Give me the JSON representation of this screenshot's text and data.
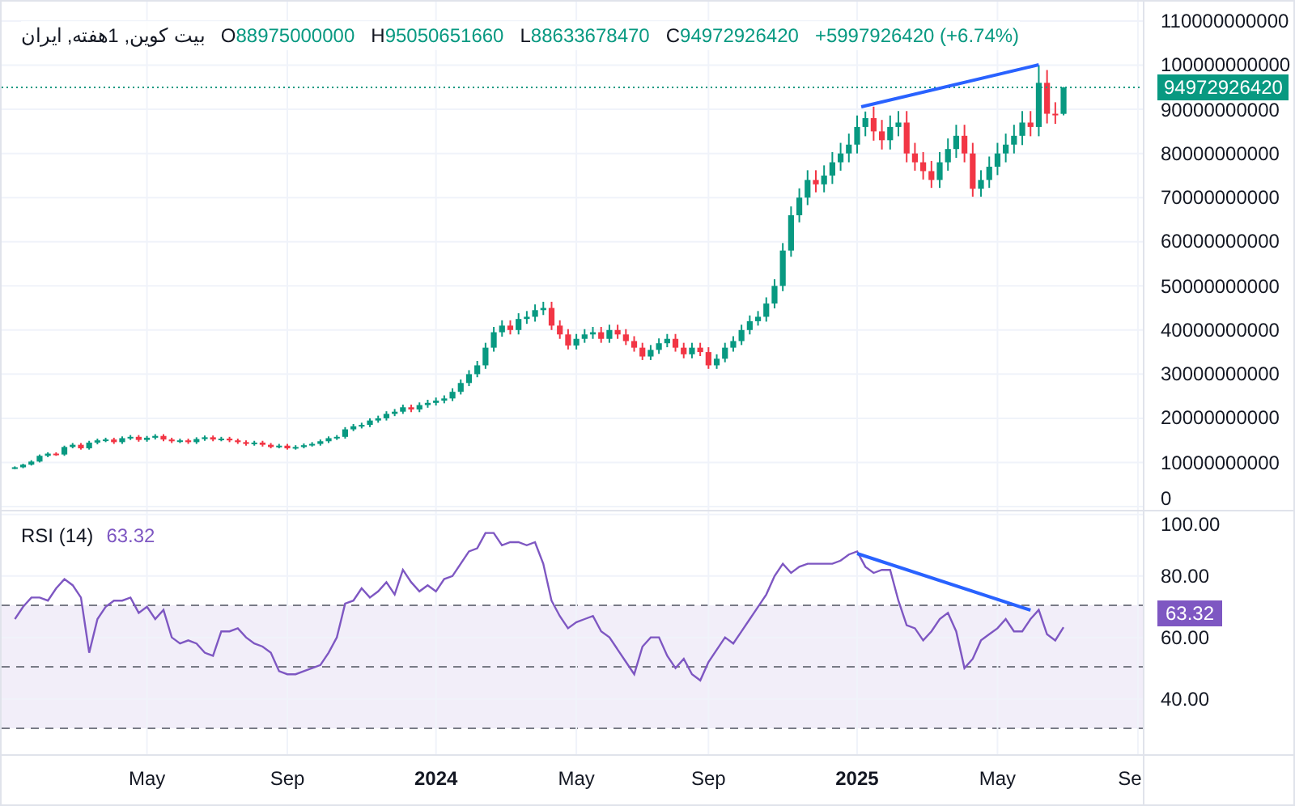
{
  "legend": {
    "symbol": "بیت کوین, 1هفته, ایران",
    "fields": [
      {
        "label": "O",
        "value": "88975000000"
      },
      {
        "label": "H",
        "value": "95050651660"
      },
      {
        "label": "L",
        "value": "88633678470"
      },
      {
        "label": "C",
        "value": "94972926420"
      }
    ],
    "change": "+5997926420 (+6.74%)"
  },
  "price_pane": {
    "last_price": "94972926420",
    "trend_line": true,
    "chart_data": {
      "type": "candlestick",
      "grid": true,
      "ylim": [
        0,
        110000000000
      ],
      "ohlc": [
        [
          8700000000.0,
          9100000000.0,
          8500000000.0,
          8900000000.0
        ],
        [
          8900000000.0,
          9700000000.0,
          8700000000.0,
          9500000000.0
        ],
        [
          9500000000.0,
          10500000000.0,
          9300000000.0,
          10200000000.0
        ],
        [
          10200000000.0,
          11800000000.0,
          10000000000.0,
          11500000000.0
        ],
        [
          11500000000.0,
          12300000000.0,
          11200000000.0,
          12000000000.0
        ],
        [
          12000000000.0,
          12300000000.0,
          11500000000.0,
          11800000000.0
        ],
        [
          11800000000.0,
          13800000000.0,
          11500000000.0,
          13500000000.0
        ],
        [
          13500000000.0,
          14400000000.0,
          13200000000.0,
          14000000000.0
        ],
        [
          14000000000.0,
          14400000000.0,
          12900000000.0,
          13200000000.0
        ],
        [
          13200000000.0,
          14900000000.0,
          12900000000.0,
          14500000000.0
        ],
        [
          14500000000.0,
          15400000000.0,
          14100000000.0,
          15000000000.0
        ],
        [
          15000000000.0,
          15600000000.0,
          14600000000.0,
          15200000000.0
        ],
        [
          15200000000.0,
          15600000000.0,
          14200000000.0,
          14600000000.0
        ],
        [
          14600000000.0,
          15900000000.0,
          14200000000.0,
          15500000000.0
        ],
        [
          15500000000.0,
          16200000000.0,
          15100000000.0,
          15800000000.0
        ],
        [
          15800000000.0,
          16200000000.0,
          14700000000.0,
          15100000000.0
        ],
        [
          15100000000.0,
          16000000000.0,
          14700000000.0,
          15600000000.0
        ],
        [
          15600000000.0,
          16400000000.0,
          15200000000.0,
          16000000000.0
        ],
        [
          16000000000.0,
          16400000000.0,
          14800000000.0,
          15200000000.0
        ],
        [
          15200000000.0,
          15600000000.0,
          14400000000.0,
          14800000000.0
        ],
        [
          14800000000.0,
          15400000000.0,
          14400000000.0,
          15000000000.0
        ],
        [
          15000000000.0,
          15400000000.0,
          14200000000.0,
          14600000000.0
        ],
        [
          14600000000.0,
          15700000000.0,
          14200000000.0,
          15300000000.0
        ],
        [
          15300000000.0,
          16100000000.0,
          14900000000.0,
          15700000000.0
        ],
        [
          15700000000.0,
          16100000000.0,
          14800000000.0,
          15200000000.0
        ],
        [
          15200000000.0,
          15800000000.0,
          14800000000.0,
          15400000000.0
        ],
        [
          15400000000.0,
          15800000000.0,
          14600000000.0,
          15000000000.0
        ],
        [
          15000000000.0,
          15400000000.0,
          14200000000.0,
          14600000000.0
        ],
        [
          14600000000.0,
          15000000000.0,
          13800000000.0,
          14200000000.0
        ],
        [
          14200000000.0,
          14900000000.0,
          13800000000.0,
          14500000000.0
        ],
        [
          14500000000.0,
          14900000000.0,
          13600000000.0,
          14000000000.0
        ],
        [
          14000000000.0,
          14400000000.0,
          13200000000.0,
          13500000000.0
        ],
        [
          13500000000.0,
          14200000000.0,
          13200000000.0,
          13800000000.0
        ],
        [
          13800000000.0,
          14200000000.0,
          12900000000.0,
          13200000000.0
        ],
        [
          13200000000.0,
          13900000000.0,
          12900000000.0,
          13500000000.0
        ],
        [
          13500000000.0,
          14300000000.0,
          13200000000.0,
          13900000000.0
        ],
        [
          13900000000.0,
          14600000000.0,
          13600000000.0,
          14200000000.0
        ],
        [
          14200000000.0,
          15200000000.0,
          13800000000.0,
          14800000000.0
        ],
        [
          14800000000.0,
          15900000000.0,
          14400000000.0,
          15500000000.0
        ],
        [
          15500000000.0,
          16200000000.0,
          15100000000.0,
          15800000000.0
        ],
        [
          15800000000.0,
          18000000000.0,
          15400000000.0,
          17500000000.0
        ],
        [
          17500000000.0,
          18700000000.0,
          17100000000.0,
          18200000000.0
        ],
        [
          18200000000.0,
          19000000000.0,
          17700000000.0,
          18500000000.0
        ],
        [
          18500000000.0,
          20000000000.0,
          18000000000.0,
          19500000000.0
        ],
        [
          19500000000.0,
          20600000000.0,
          19000000000.0,
          20000000000.0
        ],
        [
          20000000000.0,
          21600000000.0,
          19500000000.0,
          21000000000.0
        ],
        [
          21000000000.0,
          22100000000.0,
          20500000000.0,
          21500000000.0
        ],
        [
          21500000000.0,
          23100000000.0,
          21000000000.0,
          22500000000.0
        ],
        [
          22500000000.0,
          23100000000.0,
          21400000000.0,
          22000000000.0
        ],
        [
          22000000000.0,
          23600000000.0,
          21400000000.0,
          23000000000.0
        ],
        [
          23000000000.0,
          24200000000.0,
          22400000000.0,
          23500000000.0
        ],
        [
          23500000000.0,
          24700000000.0,
          22900000000.0,
          24000000000.0
        ],
        [
          24000000000.0,
          25200000000.0,
          23400000000.0,
          24500000000.0
        ],
        [
          24500000000.0,
          26800000000.0,
          23900000000.0,
          26000000000.0
        ],
        [
          26000000000.0,
          28800000000.0,
          25400000000.0,
          28000000000.0
        ],
        [
          28000000000.0,
          30900000000.0,
          27300000000.0,
          30000000000.0
        ],
        [
          30000000000.0,
          33000000000.0,
          29300000000.0,
          32000000000.0
        ],
        [
          32000000000.0,
          37100000000.0,
          31200000000.0,
          36000000000.0
        ],
        [
          36000000000.0,
          40700000000.0,
          35100000000.0,
          39500000000.0
        ],
        [
          39500000000.0,
          42200000000.0,
          38500000000.0,
          41000000000.0
        ],
        [
          41000000000.0,
          42200000000.0,
          39000000000.0,
          40000000000.0
        ],
        [
          40000000000.0,
          43800000000.0,
          39000000000.0,
          42500000000.0
        ],
        [
          42500000000.0,
          44300000000.0,
          41400000000.0,
          43000000000.0
        ],
        [
          43000000000.0,
          45800000000.0,
          41900000000.0,
          44500000000.0
        ],
        [
          44500000000.0,
          46400000000.0,
          43400000000.0,
          45000000000.0
        ],
        [
          45000000000.0,
          46400000000.0,
          40000000000.0,
          41000000000.0
        ],
        [
          41000000000.0,
          42200000000.0,
          38000000000.0,
          39000000000.0
        ],
        [
          39000000000.0,
          40200000000.0,
          35600000000.0,
          36500000000.0
        ],
        [
          36500000000.0,
          39100000000.0,
          35600000000.0,
          38000000000.0
        ],
        [
          38000000000.0,
          40200000000.0,
          37100000000.0,
          39000000000.0
        ],
        [
          39000000000.0,
          40700000000.0,
          38000000000.0,
          39500000000.0
        ],
        [
          39500000000.0,
          40700000000.0,
          37100000000.0,
          38000000000.0
        ],
        [
          38000000000.0,
          41200000000.0,
          37100000000.0,
          40000000000.0
        ],
        [
          40000000000.0,
          41200000000.0,
          38000000000.0,
          39000000000.0
        ],
        [
          39000000000.0,
          40200000000.0,
          36600000000.0,
          37500000000.0
        ],
        [
          37500000000.0,
          38600000000.0,
          35100000000.0,
          36000000000.0
        ],
        [
          36000000000.0,
          37100000000.0,
          33200000000.0,
          34000000000.0
        ],
        [
          34000000000.0,
          36600000000.0,
          33200000000.0,
          35500000000.0
        ],
        [
          35500000000.0,
          38100000000.0,
          34600000000.0,
          37000000000.0
        ],
        [
          37000000000.0,
          39100000000.0,
          36100000000.0,
          38000000000.0
        ],
        [
          38000000000.0,
          39100000000.0,
          35100000000.0,
          36000000000.0
        ],
        [
          36000000000.0,
          37100000000.0,
          33600000000.0,
          34500000000.0
        ],
        [
          34500000000.0,
          37100000000.0,
          33600000000.0,
          36000000000.0
        ],
        [
          36000000000.0,
          37100000000.0,
          34100000000.0,
          35000000000.0
        ],
        [
          35000000000.0,
          36100000000.0,
          31200000000.0,
          32000000000.0
        ],
        [
          32000000000.0,
          34500000000.0,
          31200000000.0,
          33500000000.0
        ],
        [
          33500000000.0,
          37100000000.0,
          32700000000.0,
          36000000000.0
        ],
        [
          36000000000.0,
          38600000000.0,
          35100000000.0,
          37500000000.0
        ],
        [
          37500000000.0,
          41200000000.0,
          36600000000.0,
          40000000000.0
        ],
        [
          40000000000.0,
          43300000000.0,
          39000000000.0,
          42000000000.0
        ],
        [
          42000000000.0,
          44300000000.0,
          41000000000.0,
          43000000000.0
        ],
        [
          43000000000.0,
          47400000000.0,
          41900000000.0,
          46000000000.0
        ],
        [
          46000000000.0,
          51500000000.0,
          44900000000.0,
          50000000000.0
        ],
        [
          50000000000.0,
          59700000000.0,
          48800000000.0,
          58000000000.0
        ],
        [
          58000000000.0,
          68000000000.0,
          56600000000.0,
          66000000000.0
        ],
        [
          66000000000.0,
          72100000000.0,
          64400000000.0,
          70000000000.0
        ],
        [
          70000000000.0,
          76200000000.0,
          68300000000.0,
          74000000000.0
        ],
        [
          74000000000.0,
          76200000000.0,
          71200000000.0,
          73000000000.0
        ],
        [
          73000000000.0,
          77300000000.0,
          71200000000.0,
          75000000000.0
        ],
        [
          75000000000.0,
          80300000000.0,
          73100000000.0,
          78000000000.0
        ],
        [
          78000000000.0,
          82400000000.0,
          76100000000.0,
          80000000000.0
        ],
        [
          80000000000.0,
          84500000000.0,
          78000000000.0,
          82000000000.0
        ],
        [
          82000000000.0,
          88600000000.0,
          80000000000.0,
          86000000000.0
        ],
        [
          86000000000.0,
          89500000000.0,
          83900000000.0,
          88000000000.0
        ],
        [
          88000000000.0,
          90600000000.0,
          82900000000.0,
          85000000000.0
        ],
        [
          85000000000.0,
          87600000000.0,
          80900000000.0,
          83000000000.0
        ],
        [
          83000000000.0,
          88600000000.0,
          80900000000.0,
          86000000000.0
        ],
        [
          86000000000.0,
          89600000000.0,
          83900000000.0,
          87000000000.0
        ],
        [
          87000000000.0,
          89600000000.0,
          78000000000.0,
          80000000000.0
        ],
        [
          80000000000.0,
          82400000000.0,
          76100000000.0,
          78000000000.0
        ],
        [
          78000000000.0,
          80300000000.0,
          74100000000.0,
          76000000000.0
        ],
        [
          76000000000.0,
          78300000000.0,
          72200000000.0,
          74000000000.0
        ],
        [
          74000000000.0,
          80300000000.0,
          72200000000.0,
          78000000000.0
        ],
        [
          78000000000.0,
          83400000000.0,
          76100000000.0,
          81000000000.0
        ],
        [
          81000000000.0,
          86500000000.0,
          79000000000.0,
          84000000000.0
        ],
        [
          84000000000.0,
          86500000000.0,
          78000000000.0,
          80000000000.0
        ],
        [
          80000000000.0,
          82400000000.0,
          70200000000.0,
          72000000000.0
        ],
        [
          72000000000.0,
          76200000000.0,
          70200000000.0,
          74000000000.0
        ],
        [
          74000000000.0,
          79300000000.0,
          72200000000.0,
          77000000000.0
        ],
        [
          77000000000.0,
          82400000000.0,
          75100000000.0,
          80000000000.0
        ],
        [
          80000000000.0,
          84500000000.0,
          78000000000.0,
          82000000000.0
        ],
        [
          82000000000.0,
          86500000000.0,
          80000000000.0,
          84000000000.0
        ],
        [
          84000000000.0,
          89600000000.0,
          81900000000.0,
          87000000000.0
        ],
        [
          87000000000.0,
          89600000000.0,
          83900000000.0,
          86000000000.0
        ],
        [
          86000000000.0,
          100000000000.0,
          83900000000.0,
          96000000000.0
        ],
        [
          96000000000.0,
          98900000000.0,
          86800000000.0,
          89000000000.0
        ],
        [
          89000000000.0,
          91600000000.0,
          86700000000.0,
          88900000000.0
        ],
        [
          88975000000,
          95050651660,
          88633678470,
          94972926420
        ],
        null,
        null,
        null,
        null,
        null,
        null,
        null,
        null,
        null
      ],
      "yticks": [
        {
          "value": 0,
          "label": "0"
        },
        {
          "value": 10000000000,
          "label": "10000000000"
        },
        {
          "value": 20000000000,
          "label": "20000000000"
        },
        {
          "value": 30000000000,
          "label": "30000000000"
        },
        {
          "value": 40000000000,
          "label": "40000000000"
        },
        {
          "value": 50000000000,
          "label": "50000000000"
        },
        {
          "value": 60000000000,
          "label": "60000000000"
        },
        {
          "value": 70000000000,
          "label": "70000000000"
        },
        {
          "value": 80000000000,
          "label": "80000000000"
        },
        {
          "value": 90000000000,
          "label": "90000000000"
        },
        {
          "value": 100000000000,
          "label": "100000000000"
        },
        {
          "value": 110000000000,
          "label": "110000000000"
        }
      ]
    }
  },
  "rsi_pane": {
    "title": "RSI (14)",
    "reading": "63.32",
    "last_value": "63.32",
    "trend_line": true,
    "time_label_bold": [
      false,
      false,
      true,
      false,
      false,
      true,
      false,
      false
    ],
    "chart_data": {
      "type": "line",
      "grid": true,
      "ylim": [
        22,
        101
      ],
      "categories": [
        null,
        null,
        null,
        null,
        null,
        null,
        null,
        null,
        null,
        null,
        null,
        null,
        null,
        null,
        null,
        null,
        "May",
        null,
        null,
        null,
        null,
        null,
        null,
        null,
        null,
        null,
        null,
        null,
        null,
        null,
        null,
        null,
        null,
        "Sep",
        null,
        null,
        null,
        null,
        null,
        null,
        null,
        null,
        null,
        null,
        null,
        null,
        null,
        null,
        null,
        null,
        null,
        "2024",
        null,
        null,
        null,
        null,
        null,
        null,
        null,
        null,
        null,
        null,
        null,
        null,
        null,
        null,
        null,
        null,
        "May",
        null,
        null,
        null,
        null,
        null,
        null,
        null,
        null,
        null,
        null,
        null,
        null,
        null,
        null,
        null,
        "Sep",
        null,
        null,
        null,
        null,
        null,
        null,
        null,
        null,
        null,
        null,
        null,
        null,
        null,
        null,
        null,
        null,
        null,
        "2025",
        null,
        null,
        null,
        null,
        null,
        null,
        null,
        null,
        null,
        null,
        null,
        null,
        null,
        null,
        null,
        null,
        "May",
        null,
        null,
        null,
        null,
        null,
        null,
        null,
        null,
        null,
        null,
        null,
        null,
        null,
        null,
        null,
        null,
        "Se"
      ],
      "series": [
        {
          "color": "#7e57c2",
          "values": [
            66,
            70,
            73,
            73,
            72,
            76,
            79,
            77,
            73,
            55,
            66,
            70,
            72,
            72,
            73,
            68,
            70,
            66,
            69,
            60,
            58,
            59,
            58,
            55,
            54,
            62,
            62,
            63,
            60,
            58,
            57,
            55,
            49,
            48,
            48,
            49,
            50,
            51,
            55,
            60,
            71,
            72,
            76,
            73,
            75,
            78,
            74,
            82,
            78,
            75,
            77,
            75,
            79,
            80,
            84,
            88,
            89,
            94,
            94,
            90,
            91,
            91,
            90,
            91,
            84,
            72,
            67,
            63,
            65,
            66,
            67,
            62,
            60,
            56,
            52,
            48,
            57,
            60,
            60,
            54,
            50,
            53,
            48,
            46,
            52,
            56,
            60,
            58,
            62,
            66,
            70,
            74,
            80,
            84,
            81,
            83,
            84,
            84,
            84,
            84,
            85,
            87,
            88,
            83,
            81,
            82,
            82,
            72,
            64,
            63,
            59,
            62,
            66,
            68,
            62,
            50,
            53,
            59,
            61,
            63,
            66,
            62,
            62,
            66,
            69,
            61,
            59,
            63.3,
            null,
            null,
            null,
            null,
            null,
            null,
            null,
            null,
            null
          ]
        }
      ],
      "yticks": [
        {
          "value": 40,
          "label": "40.00"
        },
        {
          "value": 60,
          "label": "60.00"
        },
        {
          "value": 80,
          "label": "80.00"
        },
        {
          "value": 100,
          "label": "100.00"
        }
      ]
    }
  }
}
